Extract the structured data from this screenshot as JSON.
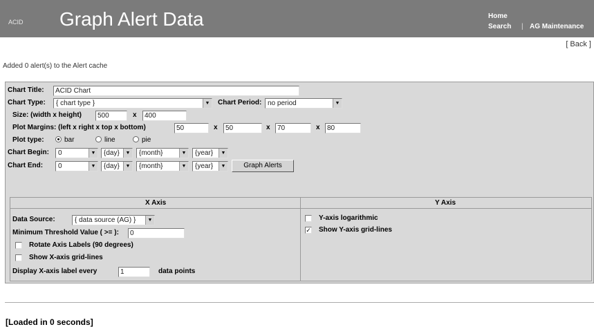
{
  "header": {
    "brand": "ACID",
    "title": "Graph Alert Data",
    "nav": {
      "home": "Home",
      "search": "Search",
      "separator": "|",
      "maintenance": "AG Maintenance"
    }
  },
  "back_link": "[ Back ]",
  "status_message": "Added 0 alert(s) to the Alert cache",
  "form": {
    "chart_title_label": "Chart Title:",
    "chart_title_value": "ACID Chart",
    "chart_type_label": "Chart Type:",
    "chart_type_value": "{ chart type }",
    "chart_period_label": "Chart Period:",
    "chart_period_value": "no period",
    "size_label": "Size: (width x height)",
    "size_width": "500",
    "size_x": "x",
    "size_height": "400",
    "margins_label": "Plot Margins: (left x right x top x bottom)",
    "margin_left": "50",
    "margin_right": "50",
    "margin_top": "70",
    "margin_bottom": "80",
    "plot_type_label": "Plot type:",
    "plot_type_options": [
      "bar",
      "line",
      "pie"
    ],
    "plot_type_selected": "bar",
    "chart_begin_label": "Chart Begin:",
    "chart_end_label": "Chart End:",
    "begin": {
      "hour": "0",
      "day": "{day}",
      "month": "{month}",
      "year": "{year}"
    },
    "end": {
      "hour": "0",
      "day": "{day}",
      "month": "{month}",
      "year": "{year}"
    },
    "graph_button": "Graph Alerts"
  },
  "x_axis": {
    "heading": "X Axis",
    "data_source_label": "Data Source:",
    "data_source_value": "{ data source (AG) }",
    "min_threshold_label": "Minimum Threshold Value ( >= ):",
    "min_threshold_value": "0",
    "rotate_labels": "Rotate Axis Labels (90 degrees)",
    "rotate_checked": false,
    "show_grid": "Show X-axis grid-lines",
    "show_grid_checked": false,
    "display_every_label": "Display X-axis label every",
    "display_every_value": "1",
    "display_every_suffix": "data points"
  },
  "y_axis": {
    "heading": "Y Axis",
    "logarithmic": "Y-axis logarithmic",
    "logarithmic_checked": false,
    "show_grid": "Show Y-axis grid-lines",
    "show_grid_checked": true
  },
  "footer": {
    "loaded": "[Loaded in 0 seconds]"
  }
}
